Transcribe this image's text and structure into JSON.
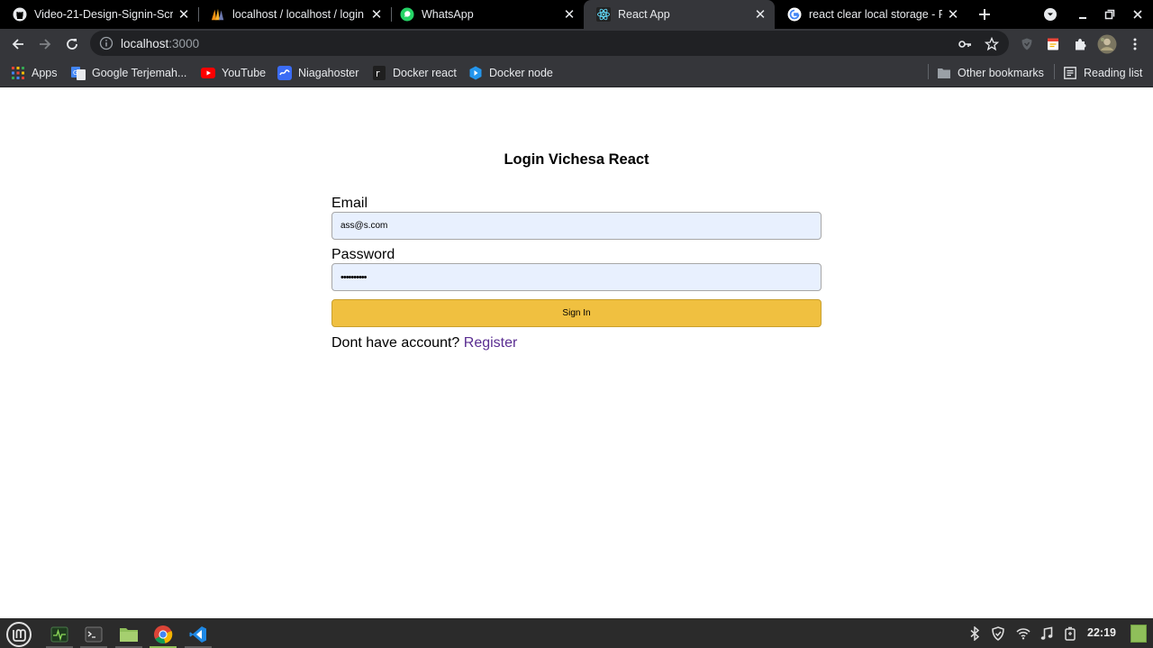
{
  "browser": {
    "tabs": [
      {
        "title": "Video-21-Design-Signin-Scre",
        "icon": "github-icon"
      },
      {
        "title": "localhost / localhost / login",
        "icon": "phpmyadmin-icon"
      },
      {
        "title": "WhatsApp",
        "icon": "whatsapp-icon"
      },
      {
        "title": "React App",
        "icon": "react-icon",
        "active": true
      },
      {
        "title": "react clear local storage - P",
        "icon": "google-icon"
      }
    ],
    "url_host": "localhost",
    "url_port": ":3000",
    "bookmarks": {
      "apps": "Apps",
      "google_translate": "Google Terjemah...",
      "youtube": "YouTube",
      "niagahoster": "Niagahoster",
      "docker_react": "Docker react",
      "docker_node": "Docker node",
      "other": "Other bookmarks",
      "reading_list": "Reading list"
    }
  },
  "page": {
    "title": "Login Vichesa React",
    "email_label": "Email",
    "email_value": "ass@s.com",
    "password_label": "Password",
    "password_value": "••••••••••",
    "signin_label": "Sign In",
    "no_account_text": "Dont have account? ",
    "register_label": "Register"
  },
  "taskbar": {
    "clock": "22:19"
  },
  "colors": {
    "button": "#f0c040",
    "input_bg": "#e8f0fe",
    "link": "#5a2d91"
  }
}
